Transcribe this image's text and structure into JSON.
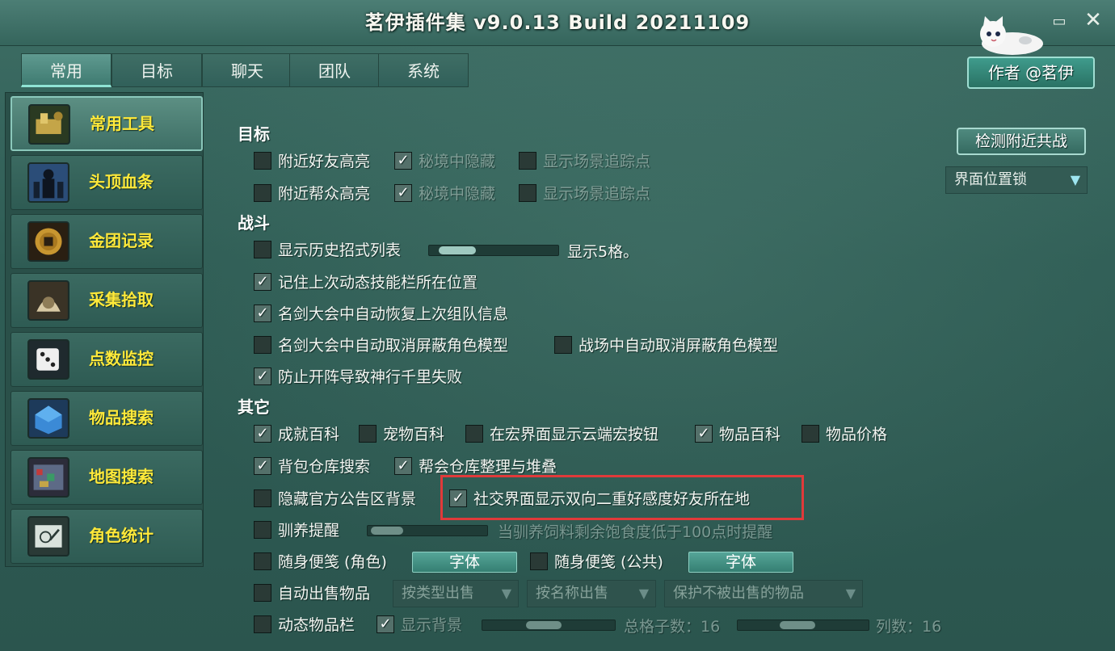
{
  "window": {
    "title": "茗伊插件集 v9.0.13 Build 20211109",
    "minimize_glyph": "▭",
    "close_glyph": "✕"
  },
  "tabs": [
    {
      "label": "常用",
      "active": true
    },
    {
      "label": "目标",
      "active": false
    },
    {
      "label": "聊天",
      "active": false
    },
    {
      "label": "团队",
      "active": false
    },
    {
      "label": "系统",
      "active": false
    }
  ],
  "author_button": "作者 @茗伊",
  "sidebar": {
    "items": [
      {
        "label": "常用工具",
        "icon": "tools-icon",
        "active": true
      },
      {
        "label": "头顶血条",
        "icon": "health-bar-icon",
        "active": false
      },
      {
        "label": "金团记录",
        "icon": "coin-icon",
        "active": false
      },
      {
        "label": "采集拾取",
        "icon": "gather-icon",
        "active": false
      },
      {
        "label": "点数监控",
        "icon": "dice-icon",
        "active": false
      },
      {
        "label": "物品搜索",
        "icon": "item-search-icon",
        "active": false
      },
      {
        "label": "地图搜索",
        "icon": "map-search-icon",
        "active": false
      },
      {
        "label": "角色统计",
        "icon": "character-stats-icon",
        "active": false
      }
    ]
  },
  "right_panel": {
    "detect_button": "检测附近共战",
    "ui_position_dropdown": "界面位置锁"
  },
  "sections": {
    "target": {
      "title": "目标",
      "row1": [
        {
          "label": "附近好友高亮",
          "checked": false,
          "dim": false
        },
        {
          "label": "秘境中隐藏",
          "checked": true,
          "dim": true
        },
        {
          "label": "显示场景追踪点",
          "checked": false,
          "dim": true
        }
      ],
      "row2": [
        {
          "label": "附近帮众高亮",
          "checked": false,
          "dim": false
        },
        {
          "label": "秘境中隐藏",
          "checked": true,
          "dim": true
        },
        {
          "label": "显示场景追踪点",
          "checked": false,
          "dim": true
        }
      ]
    },
    "combat": {
      "title": "战斗",
      "history": {
        "label": "显示历史招式列表",
        "checked": false,
        "slider_value": 5,
        "slider_text": "显示5格。"
      },
      "items": [
        {
          "label": "记住上次动态技能栏所在位置",
          "checked": true
        },
        {
          "label": "名剑大会中自动恢复上次组队信息",
          "checked": true
        }
      ],
      "row_hide_models": [
        {
          "label": "名剑大会中自动取消屏蔽角色模型",
          "checked": false
        },
        {
          "label": "战场中自动取消屏蔽角色模型",
          "checked": false
        }
      ],
      "prevent": {
        "label": "防止开阵导致神行千里失败",
        "checked": true
      }
    },
    "other": {
      "title": "其它",
      "row1": [
        {
          "label": "成就百科",
          "checked": true
        },
        {
          "label": "宠物百科",
          "checked": false
        },
        {
          "label": "在宏界面显示云端宏按钮",
          "checked": false
        },
        {
          "label": "物品百科",
          "checked": true
        },
        {
          "label": "物品价格",
          "checked": false
        }
      ],
      "row2": [
        {
          "label": "背包仓库搜索",
          "checked": true
        },
        {
          "label": "帮会仓库整理与堆叠",
          "checked": true
        }
      ],
      "row3": [
        {
          "label": "隐藏官方公告区背景",
          "checked": false
        },
        {
          "label": "社交界面显示双向二重好感度好友所在地",
          "checked": true
        }
      ],
      "reminder": {
        "label": "驯养提醒",
        "checked": false,
        "hint": "当驯养饲料剩余饱食度低于100点时提醒"
      },
      "memo_role": {
        "label": "随身便笺 (角色)",
        "checked": false,
        "button": "字体"
      },
      "memo_public": {
        "label": "随身便笺 (公共)",
        "checked": false,
        "button": "字体"
      },
      "auto_sell": {
        "label": "自动出售物品",
        "checked": false,
        "dropdown1": "按类型出售",
        "dropdown2": "按名称出售",
        "dropdown3": "保护不被出售的物品"
      },
      "dynamic_bar": {
        "label": "动态物品栏",
        "checked": false,
        "display_label": "显示背景",
        "display_checked": true,
        "total_slots_text": "总格子数：16",
        "columns_text": "列数：16"
      }
    }
  },
  "colors": {
    "accent_label": "#ffe93a",
    "highlight_box": "#e03a3a",
    "background": "#2f5a52"
  }
}
